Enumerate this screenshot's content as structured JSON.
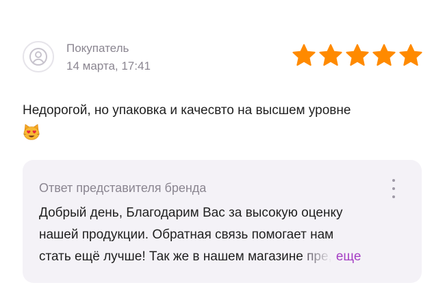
{
  "review": {
    "author": "Покупатель",
    "date": "14 марта, 17:41",
    "rating": 5,
    "rating_max": 5,
    "text": "Недорогой, но упаковка и качесвто на высшем уровне",
    "emoji": "smiling-face-with-heart-eyes-cat",
    "star_color": "#ff8a00",
    "avatar_icon": "user-icon"
  },
  "brand_reply": {
    "title": "Ответ представителя бренда",
    "lines": [
      "Добрый день, Благодарим Вас за высокую оценку",
      "нашей продукции. Обратная связь помогает нам",
      "стать ещё лучше! Так же в нашем магазине "
    ],
    "truncated_fragment": "пре,",
    "more_label": "еще",
    "more_color": "#a53fc4",
    "menu_icon": "more-vertical-icon",
    "background": "#f4f2f7"
  }
}
